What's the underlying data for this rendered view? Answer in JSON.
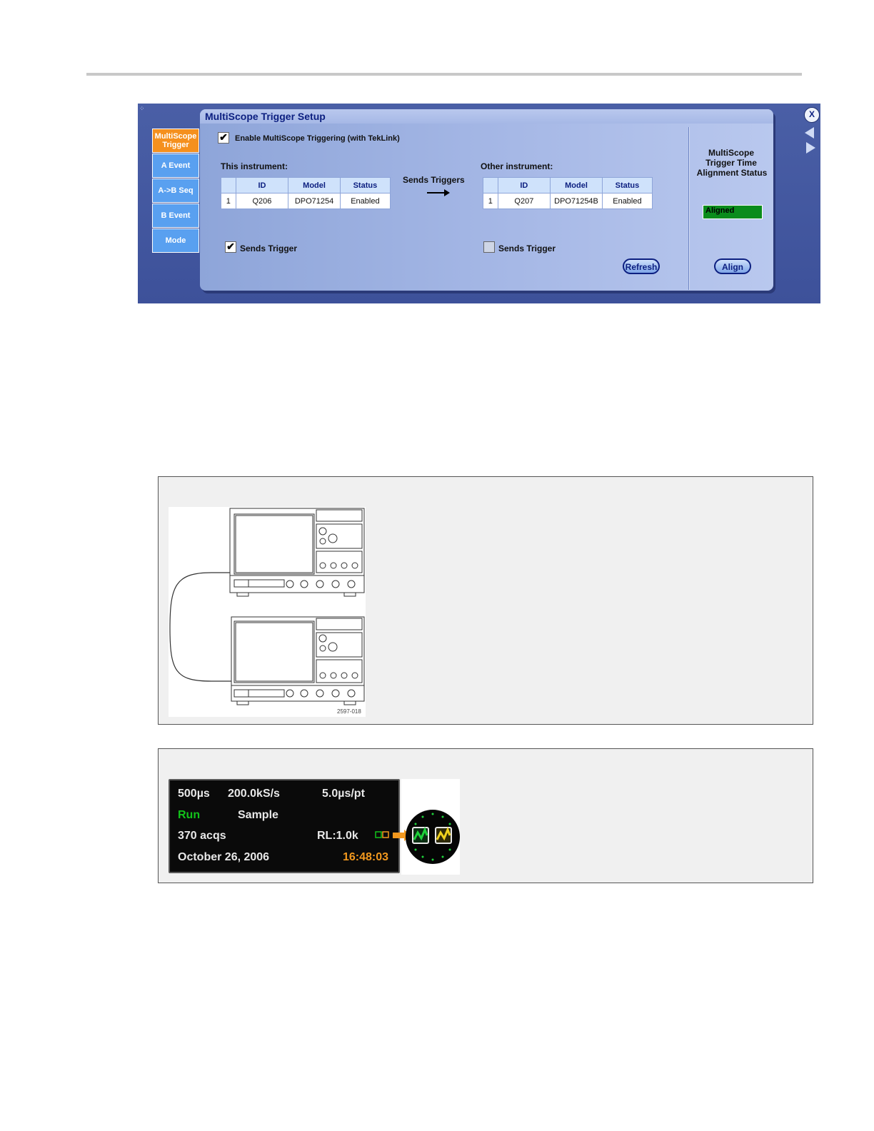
{
  "dialog": {
    "title": "MultiScope Trigger Setup",
    "close_label": "X",
    "tabs": [
      "MultiScope Trigger",
      "A Event",
      "A->B Seq",
      "B Event",
      "Mode"
    ],
    "enable_label": "Enable MultiScope Triggering (with TekLink)",
    "enable_checked": "✔",
    "this_instrument": {
      "heading": "This instrument:",
      "columns": [
        "ID",
        "Model",
        "Status"
      ],
      "row": [
        "1",
        "Q206",
        "DPO71254",
        "Enabled"
      ],
      "sends_trigger_label": "Sends Trigger",
      "sends_trigger_checked": "✔"
    },
    "sends_triggers_label": "Sends Triggers",
    "other_instrument": {
      "heading": "Other instrument:",
      "columns": [
        "ID",
        "Model",
        "Status"
      ],
      "row": [
        "1",
        "Q207",
        "DPO71254B",
        "Enabled"
      ],
      "sends_trigger_label": "Sends Trigger"
    },
    "refresh_label": "Refresh",
    "alignment": {
      "title_line1": "MultiScope",
      "title_line2": "Trigger Time",
      "title_line3": "Alignment Status",
      "status": "Aligned",
      "align_label": "Align"
    }
  },
  "figure1": {
    "code": "2597-018"
  },
  "status_readout": {
    "timebase": "500µs",
    "sample_rate": "200.0kS/s",
    "resolution": "5.0µs/pt",
    "run_state": "Run",
    "acq_mode": "Sample",
    "acqs": "370 acqs",
    "record_length": "RL:1.0k",
    "date": "October 26, 2006",
    "time": "16:48:03"
  }
}
